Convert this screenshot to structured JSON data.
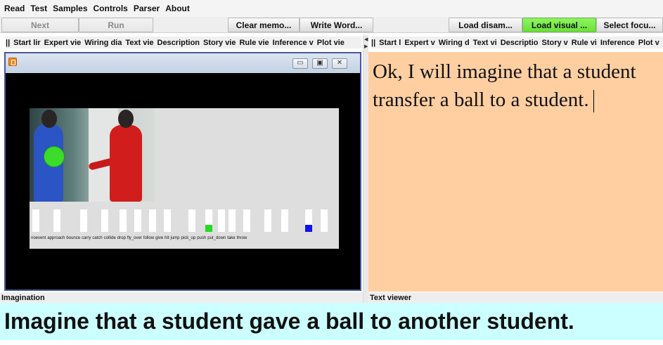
{
  "menubar": {
    "items": [
      "Read",
      "Test",
      "Samples",
      "Controls",
      "Parser",
      "About"
    ]
  },
  "toolbar": {
    "buttons": [
      "Next",
      "Run",
      "Clear memo...",
      "Write Word...",
      "Load disam...",
      "Load visual ...",
      "Select focu..."
    ]
  },
  "left_tabs": [
    "||",
    "Start lir",
    "Expert vie",
    "Wiring dia",
    "Text vie",
    "Description",
    "Story vie",
    "Rule vie",
    "Inference v",
    "Plot vie"
  ],
  "right_tabs": [
    "||",
    "Start l",
    "Expert v",
    "Wiring d",
    "Text vi",
    "Descriptio",
    "Story v",
    "Rule vi",
    "Inference",
    "Plot v"
  ],
  "imagination": {
    "panel_label": "Imagination",
    "activity_labels": [
      "noevent",
      "approach",
      "bounce",
      "carry",
      "catch",
      "collide",
      "drop",
      "fly_over",
      "follow",
      "give",
      "hit",
      "jump",
      "pick_up",
      "push",
      "put_down",
      "take",
      "throw"
    ],
    "active": {
      "give": "#22dd22",
      "take": "#1111ee"
    }
  },
  "text_viewer": {
    "panel_label": "Text viewer",
    "text": "Ok, I will imagine that a student transfer a ball to a student."
  },
  "command": {
    "text": "Imagine that a student gave a ball to another student."
  },
  "colors": {
    "text_viewer_bg": "#ffcfa2",
    "command_bg": "#ccffff",
    "load_visual_button": "#7ef24c"
  }
}
